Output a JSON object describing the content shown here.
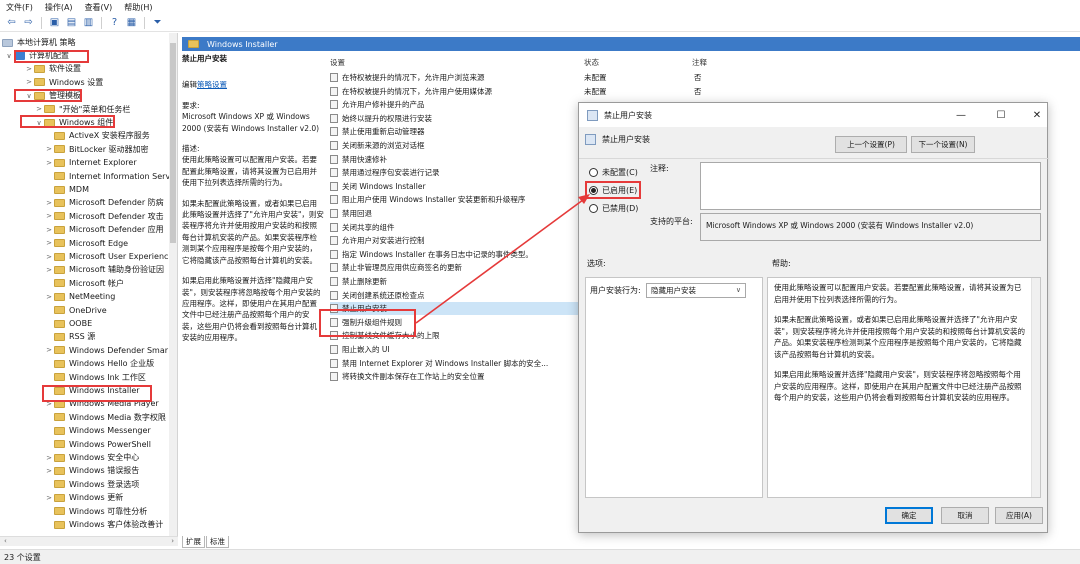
{
  "menu": [
    "文件(F)",
    "操作(A)",
    "查看(V)",
    "帮助(H)"
  ],
  "tree": {
    "root": "本地计算机 策略",
    "items": [
      {
        "label": "计算机配置",
        "level": 1,
        "arrow": "∨",
        "icon": "pc"
      },
      {
        "label": "软件设置",
        "level": 2,
        "arrow": ">"
      },
      {
        "label": "Windows 设置",
        "level": 2,
        "arrow": ">"
      },
      {
        "label": "管理模板",
        "level": 2,
        "arrow": "∨"
      },
      {
        "label": "\"开始\"菜单和任务栏",
        "level": 3,
        "arrow": ">"
      },
      {
        "label": "Windows 组件",
        "level": 3,
        "arrow": "∨"
      },
      {
        "label": "ActiveX 安装程序服务",
        "level": 4,
        "arrow": ""
      },
      {
        "label": "BitLocker 驱动器加密",
        "level": 4,
        "arrow": ">"
      },
      {
        "label": "Internet Explorer",
        "level": 4,
        "arrow": ">"
      },
      {
        "label": "Internet Information Serv",
        "level": 4,
        "arrow": ""
      },
      {
        "label": "MDM",
        "level": 4,
        "arrow": ""
      },
      {
        "label": "Microsoft Defender 防病",
        "level": 4,
        "arrow": ">"
      },
      {
        "label": "Microsoft Defender 攻击",
        "level": 4,
        "arrow": ">"
      },
      {
        "label": "Microsoft Defender 应用",
        "level": 4,
        "arrow": ">"
      },
      {
        "label": "Microsoft Edge",
        "level": 4,
        "arrow": ">"
      },
      {
        "label": "Microsoft User Experienc",
        "level": 4,
        "arrow": ">"
      },
      {
        "label": "Microsoft 辅助身份验证因",
        "level": 4,
        "arrow": ">"
      },
      {
        "label": "Microsoft 帐户",
        "level": 4,
        "arrow": ""
      },
      {
        "label": "NetMeeting",
        "level": 4,
        "arrow": ">"
      },
      {
        "label": "OneDrive",
        "level": 4,
        "arrow": ""
      },
      {
        "label": "OOBE",
        "level": 4,
        "arrow": ""
      },
      {
        "label": "RSS 源",
        "level": 4,
        "arrow": ""
      },
      {
        "label": "Windows Defender Smar",
        "level": 4,
        "arrow": ">"
      },
      {
        "label": "Windows Hello 企业版",
        "level": 4,
        "arrow": ""
      },
      {
        "label": "Windows Ink 工作区",
        "level": 4,
        "arrow": ""
      },
      {
        "label": "Windows Installer",
        "level": 4,
        "arrow": ""
      },
      {
        "label": "Windows Media Player",
        "level": 4,
        "arrow": ">"
      },
      {
        "label": "Windows Media 数字权限",
        "level": 4,
        "arrow": ""
      },
      {
        "label": "Windows Messenger",
        "level": 4,
        "arrow": ""
      },
      {
        "label": "Windows PowerShell",
        "level": 4,
        "arrow": ""
      },
      {
        "label": "Windows 安全中心",
        "level": 4,
        "arrow": ">"
      },
      {
        "label": "Windows 错误报告",
        "level": 4,
        "arrow": ">"
      },
      {
        "label": "Windows 登录选项",
        "level": 4,
        "arrow": ""
      },
      {
        "label": "Windows 更新",
        "level": 4,
        "arrow": ">"
      },
      {
        "label": "Windows 可靠性分析",
        "level": 4,
        "arrow": ""
      },
      {
        "label": "Windows 客户体验改善计",
        "level": 4,
        "arrow": ""
      }
    ]
  },
  "header": {
    "title": "Windows Installer"
  },
  "desc": {
    "title": "禁止用户安装",
    "edit_prefix": "编辑",
    "edit_link": "策略设置",
    "req_label": "要求:",
    "req_text": "Microsoft Windows XP 或 Windows 2000 (安装有 Windows Installer v2.0)",
    "desc_label": "描述:",
    "p1": "使用此策略设置可以配置用户安装。若要配置此策略设置，请将其设置为已启用并使用下拉列表选择所需的行为。",
    "p2": "如果未配置此策略设置，或者如果已启用此策略设置并选择了\"允许用户安装\"，则安装程序将允许并使用按用户安装的和按照每台计算机安装的产品。如果安装程序检测到某个应用程序是按每个用户安装的，它将隐藏该产品按照每台计算机的安装。",
    "p3": "如果启用此策略设置并选择\"隐藏用户安装\"，则安装程序将忽略按每个用户安装的应用程序。这样，即使用户在其用户配置文件中已经注册产品按照每个用户的安装，这些用户仍将会看到按照每台计算机安装的应用程序。"
  },
  "list": {
    "col_setting": "设置",
    "col_state": "状态",
    "col_comment": "注释",
    "rows": [
      {
        "name": "在特权被提升的情况下，允许用户浏览来源",
        "state": "未配置",
        "comment": "否"
      },
      {
        "name": "在特权被提升的情况下，允许用户使用媒体源",
        "state": "未配置",
        "comment": "否"
      },
      {
        "name": "允许用户修补提升的产品",
        "state": "",
        "comment": ""
      },
      {
        "name": "始终以提升的权限进行安装",
        "state": "",
        "comment": ""
      },
      {
        "name": "禁止使用重新启动管理器",
        "state": "",
        "comment": ""
      },
      {
        "name": "关闭新来源的浏览对话框",
        "state": "",
        "comment": ""
      },
      {
        "name": "禁用快速修补",
        "state": "",
        "comment": ""
      },
      {
        "name": "禁用通过程序包安装进行记录",
        "state": "",
        "comment": ""
      },
      {
        "name": "关闭 Windows Installer",
        "state": "",
        "comment": ""
      },
      {
        "name": "阻止用户使用 Windows Installer 安装更新和升级程序",
        "state": "",
        "comment": ""
      },
      {
        "name": "禁用回退",
        "state": "",
        "comment": ""
      },
      {
        "name": "关闭共享的组件",
        "state": "",
        "comment": ""
      },
      {
        "name": "允许用户对安装进行控制",
        "state": "",
        "comment": ""
      },
      {
        "name": "指定 Windows Installer 在事务日志中记录的事件类型。",
        "state": "",
        "comment": ""
      },
      {
        "name": "禁止非管理员应用供应商签名的更新",
        "state": "",
        "comment": ""
      },
      {
        "name": "禁止删除更新",
        "state": "",
        "comment": ""
      },
      {
        "name": "关闭创建系统还原检查点",
        "state": "",
        "comment": ""
      },
      {
        "name": "禁止用户安装",
        "state": "",
        "comment": ""
      },
      {
        "name": "强制升级组件规则",
        "state": "",
        "comment": ""
      },
      {
        "name": "控制基线文件缓存大小的上限",
        "state": "",
        "comment": ""
      },
      {
        "name": "阻止嵌入的 UI",
        "state": "",
        "comment": ""
      },
      {
        "name": "禁用 Internet Explorer 对 Windows Installer 脚本的安全...",
        "state": "",
        "comment": ""
      },
      {
        "name": "将转换文件副本保存在工作站上的安全位置",
        "state": "",
        "comment": ""
      }
    ],
    "selected_index": 17
  },
  "tabs": [
    "扩展",
    "标准"
  ],
  "status": "23 个设置",
  "dialog": {
    "title": "禁止用户安装",
    "subtitle": "禁止用户安装",
    "prev": "上一个设置(P)",
    "next": "下一个设置(N)",
    "radios": [
      "未配置(C)",
      "已启用(E)",
      "已禁用(D)"
    ],
    "radio_selected": 1,
    "comment_label": "注释:",
    "platform_label": "支持的平台:",
    "platform_value": "Microsoft Windows XP 或 Windows 2000 (安装有 Windows Installer v2.0)",
    "options_label": "选项:",
    "help_label": "帮助:",
    "option_field_label": "用户安装行为:",
    "option_value": "隐藏用户安装",
    "help_p1": "使用此策略设置可以配置用户安装。若要配置此策略设置，请将其设置为已启用并使用下拉列表选择所需的行为。",
    "help_p2": "如果未配置此策略设置，或者如果已启用此策略设置并选择了\"允许用户安装\"，则安装程序将允许并使用按照每个用户安装的和按照每台计算机安装的产品。如果安装程序检测到某个应用程序是按照每个用户安装的，它将隐藏该产品按照每台计算机的安装。",
    "help_p3": "如果启用此策略设置并选择\"隐藏用户安装\"，则安装程序将忽略按照每个用户安装的应用程序。这样，即使用户在其用户配置文件中已经注册产品按照每个用户的安装，这些用户仍将会看到按照每台计算机安装的应用程序。",
    "ok": "确定",
    "cancel": "取消",
    "apply": "应用(A)"
  },
  "colors": {
    "accent": "#3c7ac7",
    "highlight": "#e53a3a",
    "selection": "#cce4f7"
  }
}
